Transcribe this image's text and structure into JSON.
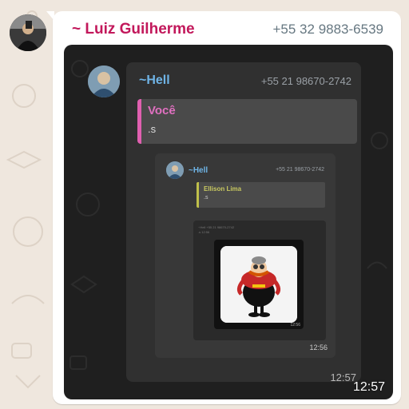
{
  "message": {
    "sender_name": "~ Luiz Guilherme",
    "sender_phone": "+55 32 9883-6539",
    "time": "12:57"
  },
  "screenshot": {
    "sender_name": "~Hell",
    "sender_phone": "+55 21 98670-2742",
    "quote": {
      "name": "Você",
      "text": ".s"
    },
    "time": "12:57",
    "nested": {
      "sender_name": "~Hell",
      "sender_phone": "+55 21 98670-2742",
      "quote": {
        "name": "Ellison Lima",
        "text": ".s"
      },
      "time": "12:56",
      "deep": {
        "sender_name": "~Hell",
        "sender_phone": "+55 21 98670-2742",
        "text": ".s",
        "time": "12:56",
        "sticker_time": "12:56"
      }
    }
  },
  "colors": {
    "chat_background": "#efe7de",
    "sender_name": "#c2185b",
    "quote_accent": "#e060b0",
    "nested_quote_accent": "#c0c04a"
  },
  "icons": [
    "avatar-photo",
    "sticker-image"
  ]
}
